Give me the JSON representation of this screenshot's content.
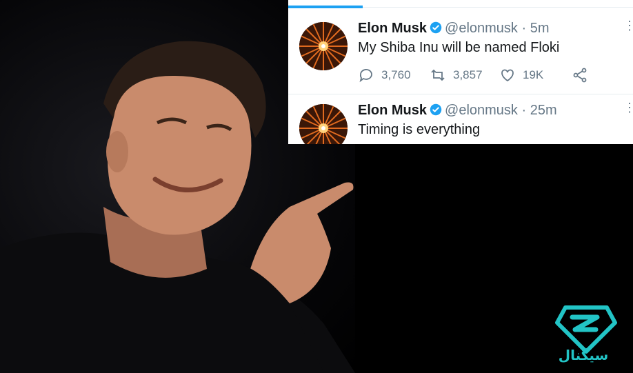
{
  "tweets": [
    {
      "name": "Elon Musk",
      "handle": "@elonmusk",
      "separator": "·",
      "time": "5m",
      "text": "My Shiba Inu will be named Floki",
      "replies": "3,760",
      "retweets": "3,857",
      "likes": "19K"
    },
    {
      "name": "Elon Musk",
      "handle": "@elonmusk",
      "separator": "·",
      "time": "25m",
      "text": "Timing is everything"
    }
  ],
  "brand": {
    "text": "سیگنال",
    "color": "#22c4c6"
  },
  "colors": {
    "twitter_blue": "#1da1f2",
    "secondary_text": "#657786"
  }
}
